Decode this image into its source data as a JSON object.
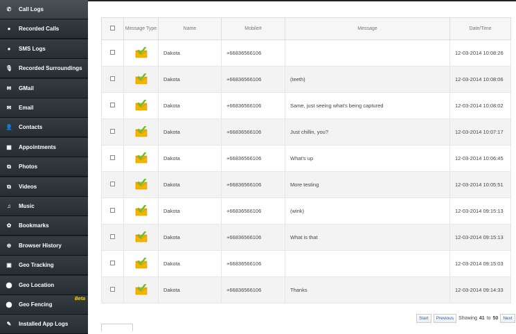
{
  "sidebar": {
    "items": [
      {
        "label": "Call Logs",
        "icon": "phone-icon",
        "glyph": "✆",
        "active": true
      },
      {
        "label": "Recorded Calls",
        "icon": "record-icon",
        "glyph": "●"
      },
      {
        "label": "SMS Logs",
        "icon": "chat-bubble-icon",
        "glyph": "●"
      },
      {
        "label": "Recorded Surroundings",
        "icon": "microphone-icon",
        "glyph": "🎙"
      },
      {
        "label": "GMail",
        "icon": "envelope-icon",
        "glyph": "✉"
      },
      {
        "label": "Email",
        "icon": "envelope-icon",
        "glyph": "✉"
      },
      {
        "label": "Contacts",
        "icon": "person-icon",
        "glyph": "👤"
      },
      {
        "label": "Appointments",
        "icon": "calendar-icon",
        "glyph": "▦"
      },
      {
        "label": "Photos",
        "icon": "photo-icon",
        "glyph": "⧉"
      },
      {
        "label": "Videos",
        "icon": "video-icon",
        "glyph": "⧉"
      },
      {
        "label": "Music",
        "icon": "music-note-icon",
        "glyph": "♫"
      },
      {
        "label": "Bookmarks",
        "icon": "bookmark-icon",
        "glyph": "✿"
      },
      {
        "label": "Browser History",
        "icon": "globe-icon",
        "glyph": "⊕"
      },
      {
        "label": "Geo Tracking",
        "icon": "map-icon",
        "glyph": "▣"
      },
      {
        "label": "Geo Location",
        "icon": "location-pin-icon",
        "glyph": "⬤"
      },
      {
        "label": "Geo Fencing",
        "icon": "geofence-pin-icon",
        "glyph": "⬤",
        "badge": "Beta"
      },
      {
        "label": "Installed App Logs",
        "icon": "app-icon",
        "glyph": "✎"
      }
    ]
  },
  "table": {
    "headers": {
      "message_type": "Message Type",
      "name": "Name",
      "mobile": "Mobile#",
      "message": "Message",
      "datetime": "Date/Time"
    },
    "rows": [
      {
        "name": "Dakota",
        "mobile": "+66836566106",
        "message": "",
        "datetime": "12-03-2014 10:08:26"
      },
      {
        "name": "Dakota",
        "mobile": "+66836566106",
        "message": "(teeth)",
        "datetime": "12-03-2014 10:08:06"
      },
      {
        "name": "Dakota",
        "mobile": "+66836566106",
        "message": "Same, just seeing what's being captured",
        "datetime": "12-03-2014 10:08:02"
      },
      {
        "name": "Dakota",
        "mobile": "+66836566106",
        "message": "Just chillin, you?",
        "datetime": "12-03-2014 10:07:17"
      },
      {
        "name": "Dakota",
        "mobile": "+66836566106",
        "message": "What's up",
        "datetime": "12-03-2014 10:06:45"
      },
      {
        "name": "Dakota",
        "mobile": "+66836566106",
        "message": "More testing",
        "datetime": "12-03-2014 10:05:51"
      },
      {
        "name": "Dakota",
        "mobile": "+66836566106",
        "message": "(wink)",
        "datetime": "12-03-2014 09:15:13"
      },
      {
        "name": "Dakota",
        "mobile": "+66836566106",
        "message": "What is that",
        "datetime": "12-03-2014 09:15:13"
      },
      {
        "name": "Dakota",
        "mobile": "+66836566106",
        "message": "",
        "datetime": "12-03-2014 09:15:03"
      },
      {
        "name": "Dakota",
        "mobile": "+66836566106",
        "message": "Thanks",
        "datetime": "12-03-2014 09:14:33"
      }
    ]
  },
  "pager": {
    "start": "Start",
    "previous": "Previous",
    "showing": "Showing",
    "from": "41",
    "to_word": "to",
    "to": "50",
    "next": "Next"
  },
  "colors": {
    "sidebar_bg": "#1d2327",
    "beta": "#ffd800",
    "envelope": "#f4b400",
    "check": "#6cbf2a"
  }
}
